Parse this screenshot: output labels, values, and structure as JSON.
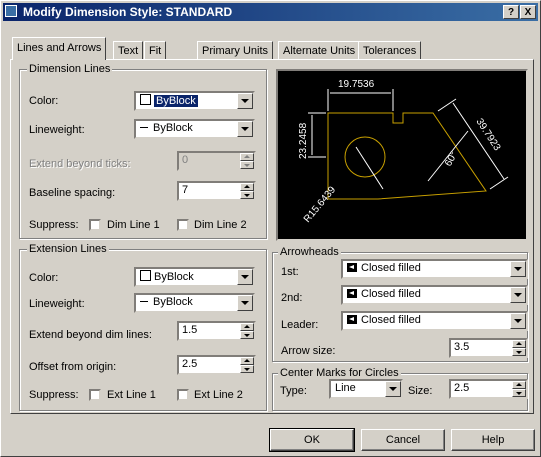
{
  "window": {
    "title": "Modify Dimension Style: STANDARD",
    "help_btn": "?",
    "close_btn": "X"
  },
  "tabs": [
    {
      "label": "Lines and Arrows",
      "active": true
    },
    {
      "label": "Text",
      "active": false
    },
    {
      "label": "Fit",
      "active": false
    },
    {
      "label": "Primary Units",
      "active": false
    },
    {
      "label": "Alternate Units",
      "active": false
    },
    {
      "label": "Tolerances",
      "active": false
    }
  ],
  "dimension_lines": {
    "group_label": "Dimension Lines",
    "color_label": "Color:",
    "color_value": "ByBlock",
    "lineweight_label": "Lineweight:",
    "lineweight_value": "ByBlock",
    "extend_label": "Extend beyond ticks:",
    "extend_value": "0",
    "baseline_label": "Baseline spacing:",
    "baseline_value": "7",
    "suppress_label": "Suppress:",
    "dim_line1": "Dim Line 1",
    "dim_line2": "Dim Line 2"
  },
  "extension_lines": {
    "group_label": "Extension Lines",
    "color_label": "Color:",
    "color_value": "ByBlock",
    "lineweight_label": "Lineweight:",
    "lineweight_value": "ByBlock",
    "extend_label": "Extend beyond dim lines:",
    "extend_value": "1.5",
    "offset_label": "Offset from origin:",
    "offset_value": "2.5",
    "suppress_label": "Suppress:",
    "ext_line1": "Ext Line 1",
    "ext_line2": "Ext Line 2"
  },
  "preview": {
    "dim_top": "19.7536",
    "dim_left": "23.2458",
    "dim_right": "39.7923",
    "dim_angle": "60°",
    "dim_radius": "R15.6439",
    "colors": {
      "geometry": "#c8a000",
      "dims": "#ffffff",
      "background": "#000000"
    }
  },
  "arrowheads": {
    "group_label": "Arrowheads",
    "first_label": "1st:",
    "first_value": "Closed filled",
    "second_label": "2nd:",
    "second_value": "Closed filled",
    "leader_label": "Leader:",
    "leader_value": "Closed filled",
    "size_label": "Arrow size:",
    "size_value": "3.5"
  },
  "center_marks": {
    "group_label": "Center Marks for Circles",
    "type_label": "Type:",
    "type_value": "Line",
    "size_label": "Size:",
    "size_value": "2.5"
  },
  "buttons": {
    "ok": "OK",
    "cancel": "Cancel",
    "help": "Help"
  }
}
